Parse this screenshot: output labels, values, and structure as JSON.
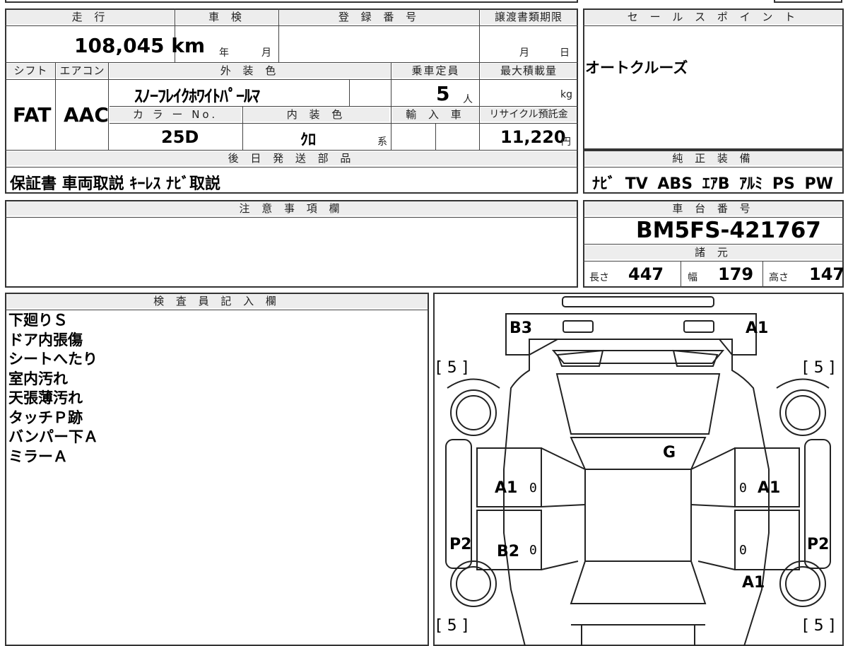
{
  "top": {
    "mileage_header": "走 行",
    "mileage_value": "108,045",
    "mileage_unit": "km",
    "inspection_header": "車 検",
    "inspection_year_label": "年",
    "inspection_month_label": "月",
    "registration_header": "登 録 番 号",
    "registration_value": "",
    "transfer_header": "譲渡書類期限",
    "transfer_month_label": "月",
    "transfer_day_label": "日",
    "shift_header": "シフト",
    "shift_value": "FAT",
    "ac_header": "エアコン",
    "ac_value": "AAC",
    "exterior_color_header": "外 装 色",
    "exterior_color_value": "ｽﾉｰﾌﾚｲｸﾎﾜｲﾄﾊﾟｰﾙﾏ",
    "capacity_header": "乗車定員",
    "capacity_value": "5",
    "capacity_unit": "人",
    "max_load_header": "最大積載量",
    "max_load_unit": "kg",
    "color_no_header": "カ ラ ー No.",
    "color_no_value": "25D",
    "interior_color_header": "内 装 色",
    "interior_color_value": "ｸﾛ",
    "interior_color_suffix": "系",
    "import_header": "輸 入 車",
    "recycle_header": "リサイクル預託金",
    "recycle_value": "11,220",
    "recycle_unit": "円",
    "later_parts_header": "後 日 発 送 部 品",
    "later_parts_value": "保証書 車両取説 ｷｰﾚｽ ﾅﾋﾞ取説"
  },
  "sales_points": {
    "header": "セ ー ル ス ポ イ ン ト",
    "value": "オートクルーズ"
  },
  "equipment": {
    "header": "純 正 装 備",
    "items": [
      "ﾅﾋﾞ",
      "TV",
      "ABS",
      "ｴｱB",
      "ｱﾙﾐ",
      "PS",
      "PW"
    ]
  },
  "notes": {
    "header": "注 意 事 項 欄",
    "value": ""
  },
  "chassis": {
    "header": "車 台 番 号",
    "value": "BM5FS-421767",
    "specs_header": "諸 元",
    "length_label": "長さ",
    "length_value": "447",
    "width_label": "幅",
    "width_value": "179",
    "height_label": "高さ",
    "height_value": "147"
  },
  "inspector": {
    "header": "検 査 員 記 入 欄",
    "lines": [
      "下廻りＳ",
      "ドア内張傷",
      "シートへたり",
      "室内汚れ",
      "天張薄汚れ",
      "タッチＰ跡",
      "バンパー下Ａ",
      "ミラーＡ"
    ]
  },
  "diagram": {
    "labels": {
      "front_left": "B3",
      "front_right": "A1",
      "tl_bracket": "[ 5 ]",
      "tr_bracket": "[ 5 ]",
      "bl_bracket": "[ 5 ]",
      "br_bracket": "[ 5 ]",
      "roof": "G",
      "left_front_door": "A1",
      "right_front_door": "A1",
      "left_rear_door": "B2",
      "left_side": "P2",
      "right_side": "P2",
      "right_rear": "A1",
      "zero": "0"
    }
  }
}
